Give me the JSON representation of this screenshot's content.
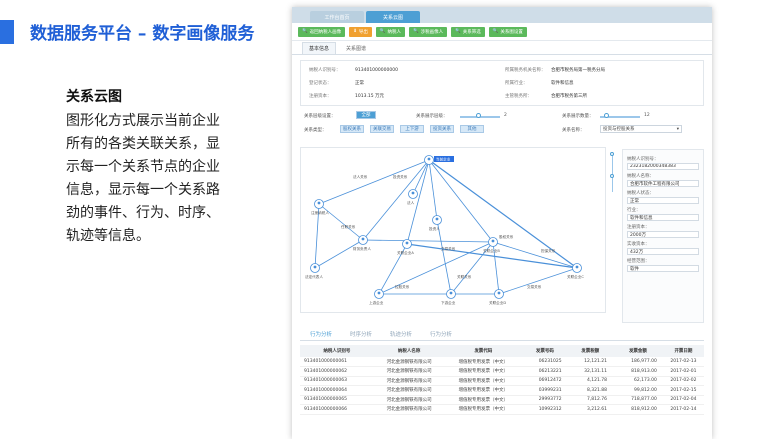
{
  "slide": {
    "title": "数据服务平台 – 数字画像服务",
    "section_heading": "关系云图",
    "section_lines": [
      "图形化方式展示当前企业",
      "所有的各类关联关系，显",
      "示每一个关系节点的企业",
      "信息，显示每一个关系路",
      "劲的事件、行为、时序、",
      "轨迹等信息。"
    ]
  },
  "app": {
    "tabs": [
      "工作台首页",
      "关系云图"
    ],
    "toolbar": [
      {
        "label": "返回纳税人画像",
        "color": "green"
      },
      {
        "label": "导出",
        "color": "orange"
      },
      {
        "label": "纳税人",
        "color": "green"
      },
      {
        "label": "涉税画像人",
        "color": "green"
      },
      {
        "label": "关系筛选",
        "color": "green"
      },
      {
        "label": "关系图设置",
        "color": "green"
      }
    ],
    "subtabs": [
      "基本信息",
      "关系图谱"
    ],
    "info": {
      "left": [
        {
          "label": "纳税人识别号：",
          "value": "913401000000000"
        },
        {
          "label": "登记状态：",
          "value": "正常"
        },
        {
          "label": "注册资本：",
          "value": "1013.15 万元"
        }
      ],
      "right": [
        {
          "label": "所属税务机关名称：",
          "value": "合肥市税务局第一税务分局"
        },
        {
          "label": "所属行业：",
          "value": "软件和信息"
        },
        {
          "label": "主管税务所：",
          "value": "合肥市税务第三所"
        }
      ]
    },
    "filters": {
      "relation_label": "关系层级设置：",
      "relation_value": "全部",
      "depth_label": "关系展示层级：",
      "depth_value": "2",
      "count_label": "关系展示数量：",
      "count_value": "12",
      "type_label": "关系类型：",
      "type_buttons": [
        "股权关系",
        "关联交易",
        "上下游",
        "投资关系",
        "其他"
      ],
      "name_label": "关系名称：",
      "name_value": "投资与控股关系"
    },
    "graph": {
      "center_tag": "当前企业",
      "nodes": [
        "注册纳税人",
        "法人",
        "投资人",
        "财务负责人",
        "关联企业A",
        "关联企业B",
        "法定代表人",
        "关联企业C",
        "上游企业",
        "下游企业",
        "关联企业D"
      ],
      "edge_labels": [
        "法人关系",
        "投资关系",
        "任职关系",
        "交易关系",
        "股权关系",
        "担保关系",
        "控股关系",
        "关联关系",
        "交易关系"
      ]
    },
    "side_panel": {
      "fields": [
        {
          "label": "纳税人识别号：",
          "value": "2323182000348383"
        },
        {
          "label": "纳税人名称：",
          "value": "合肥市软件工程有限公司"
        },
        {
          "label": "纳税人状态：",
          "value": "正常"
        },
        {
          "label": "行业：",
          "value": "软件和信息"
        },
        {
          "label": "注册资本：",
          "value": "2000万"
        },
        {
          "label": "实收资本：",
          "value": "432万"
        },
        {
          "label": "经营范围：",
          "value": "软件"
        }
      ]
    },
    "bottom_tabs": [
      "行为分析",
      "时序分析",
      "轨迹分析",
      "行为分析"
    ],
    "table": {
      "headers": [
        "纳税人识别号",
        "纳税人名称",
        "发票代码",
        "发票号码",
        "发票税额",
        "发票金额",
        "开票日期"
      ],
      "rows": [
        [
          "913401000000061",
          "河北金源钢铁有限公司",
          "增值税专用发票（中文）",
          "06231025",
          "12,121.21",
          "186,977.00",
          "2017-02-13"
        ],
        [
          "913401000000062",
          "河北金源钢铁有限公司",
          "增值税专用发票（中文）",
          "06213221",
          "32,131.11",
          "818,913.00",
          "2017-02-01"
        ],
        [
          "913401000000063",
          "河北金源钢铁有限公司",
          "增值税专用发票（中文）",
          "06912472",
          "4,121.78",
          "62,173.00",
          "2017-02-02"
        ],
        [
          "913401000000064",
          "河北金源钢铁有限公司",
          "增值税专用发票（中文）",
          "03999231",
          "8,321.88",
          "99,812.00",
          "2017-02-15"
        ],
        [
          "913401000000065",
          "河北金源钢铁有限公司",
          "增值税专用发票（中文）",
          "29993772",
          "7,812.76",
          "718,877.00",
          "2017-02-04"
        ],
        [
          "913401000000066",
          "河北金源钢铁有限公司",
          "增值税专用发票（中文）",
          "10992312",
          "3,212.61",
          "818,912.00",
          "2017-02-14"
        ]
      ]
    }
  },
  "colors": {
    "accent": "#1f5fd6",
    "app_blue": "#4d9fd4",
    "edge": "#4a90d9"
  }
}
